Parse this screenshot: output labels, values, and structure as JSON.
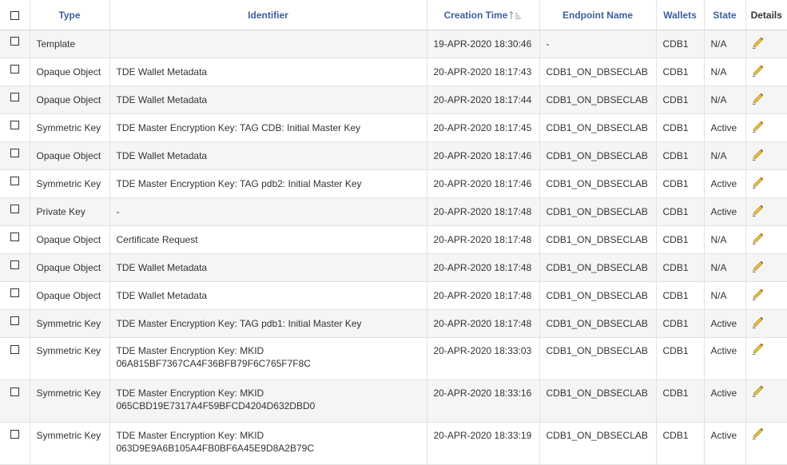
{
  "headers": {
    "type": "Type",
    "identifier": "Identifier",
    "creation_time": "Creation Time",
    "endpoint_name": "Endpoint Name",
    "wallets": "Wallets",
    "state": "State",
    "details": "Details"
  },
  "sort": {
    "column": "creation_time",
    "direction": "ascending",
    "icon": "sort-ascending-icon"
  },
  "colors": {
    "header_text": "#3d5f9e",
    "alt_row": "#f5f5f5",
    "border": "#e2e2e2",
    "pencil": "#e8c23a"
  },
  "rows": [
    {
      "type": "Template",
      "identifier": [
        "",
        ""
      ],
      "creation_time": "19-APR-2020 18:30:46",
      "endpoint_name": "-",
      "wallets": "CDB1",
      "state": "N/A"
    },
    {
      "type": "Opaque Object",
      "identifier": [
        "TDE Wallet Metadata",
        ""
      ],
      "creation_time": "20-APR-2020 18:17:43",
      "endpoint_name": "CDB1_ON_DBSECLAB",
      "wallets": "CDB1",
      "state": "N/A"
    },
    {
      "type": "Opaque Object",
      "identifier": [
        "TDE Wallet Metadata",
        ""
      ],
      "creation_time": "20-APR-2020 18:17:44",
      "endpoint_name": "CDB1_ON_DBSECLAB",
      "wallets": "CDB1",
      "state": "N/A"
    },
    {
      "type": "Symmetric Key",
      "identifier": [
        "TDE Master Encryption Key: TAG CDB: Initial Master Key",
        ""
      ],
      "creation_time": "20-APR-2020 18:17:45",
      "endpoint_name": "CDB1_ON_DBSECLAB",
      "wallets": "CDB1",
      "state": "Active"
    },
    {
      "type": "Opaque Object",
      "identifier": [
        "TDE Wallet Metadata",
        ""
      ],
      "creation_time": "20-APR-2020 18:17:46",
      "endpoint_name": "CDB1_ON_DBSECLAB",
      "wallets": "CDB1",
      "state": "N/A"
    },
    {
      "type": "Symmetric Key",
      "identifier": [
        "TDE Master Encryption Key: TAG pdb2: Initial Master Key",
        ""
      ],
      "creation_time": "20-APR-2020 18:17:46",
      "endpoint_name": "CDB1_ON_DBSECLAB",
      "wallets": "CDB1",
      "state": "Active"
    },
    {
      "type": "Private Key",
      "identifier": [
        "-",
        ""
      ],
      "creation_time": "20-APR-2020 18:17:48",
      "endpoint_name": "CDB1_ON_DBSECLAB",
      "wallets": "CDB1",
      "state": "Active"
    },
    {
      "type": "Opaque Object",
      "identifier": [
        "Certificate Request",
        ""
      ],
      "creation_time": "20-APR-2020 18:17:48",
      "endpoint_name": "CDB1_ON_DBSECLAB",
      "wallets": "CDB1",
      "state": "N/A"
    },
    {
      "type": "Opaque Object",
      "identifier": [
        "TDE Wallet Metadata",
        ""
      ],
      "creation_time": "20-APR-2020 18:17:48",
      "endpoint_name": "CDB1_ON_DBSECLAB",
      "wallets": "CDB1",
      "state": "N/A"
    },
    {
      "type": "Opaque Object",
      "identifier": [
        "TDE Wallet Metadata",
        ""
      ],
      "creation_time": "20-APR-2020 18:17:48",
      "endpoint_name": "CDB1_ON_DBSECLAB",
      "wallets": "CDB1",
      "state": "N/A"
    },
    {
      "type": "Symmetric Key",
      "identifier": [
        "TDE Master Encryption Key: TAG pdb1: Initial Master Key",
        ""
      ],
      "creation_time": "20-APR-2020 18:17:48",
      "endpoint_name": "CDB1_ON_DBSECLAB",
      "wallets": "CDB1",
      "state": "Active"
    },
    {
      "type": "Symmetric Key",
      "identifier": [
        "TDE Master Encryption Key: MKID",
        "06A815BF7367CA4F36BFB79F6C765F7F8C"
      ],
      "creation_time": "20-APR-2020 18:33:03",
      "endpoint_name": "CDB1_ON_DBSECLAB",
      "wallets": "CDB1",
      "state": "Active"
    },
    {
      "type": "Symmetric Key",
      "identifier": [
        "TDE Master Encryption Key: MKID",
        "065CBD19E7317A4F59BFCD4204D632DBD0"
      ],
      "creation_time": "20-APR-2020 18:33:16",
      "endpoint_name": "CDB1_ON_DBSECLAB",
      "wallets": "CDB1",
      "state": "Active"
    },
    {
      "type": "Symmetric Key",
      "identifier": [
        "TDE Master Encryption Key: MKID",
        "063D9E9A6B105A4FB0BF6A45E9D8A2B79C"
      ],
      "creation_time": "20-APR-2020 18:33:19",
      "endpoint_name": "CDB1_ON_DBSECLAB",
      "wallets": "CDB1",
      "state": "Active"
    }
  ]
}
